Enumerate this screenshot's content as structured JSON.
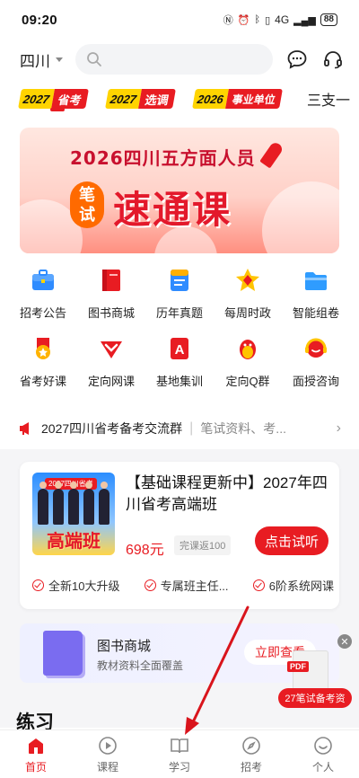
{
  "status_bar": {
    "time": "09:20",
    "signal": "4G",
    "battery": "88"
  },
  "header": {
    "location": "四川",
    "search_placeholder": ""
  },
  "tabs": [
    {
      "year": "2027",
      "kind": "省考"
    },
    {
      "year": "2027",
      "kind": "选调"
    },
    {
      "year": "2026",
      "kind": "事业单位"
    }
  ],
  "tab_more": "三支一",
  "banner": {
    "subtitle": "2026四川五方面人员",
    "badge_top": "笔",
    "badge_bottom": "试",
    "main": "速通课"
  },
  "grid": [
    {
      "label": "招考公告",
      "icon": "briefcase-icon"
    },
    {
      "label": "图书商城",
      "icon": "book-icon"
    },
    {
      "label": "历年真题",
      "icon": "exam-paper-icon"
    },
    {
      "label": "每周时政",
      "icon": "star-badge-icon"
    },
    {
      "label": "智能组卷",
      "icon": "folder-icon"
    },
    {
      "label": "省考好课",
      "icon": "medal-icon"
    },
    {
      "label": "定向网课",
      "icon": "heart-shield-icon"
    },
    {
      "label": "基地集训",
      "icon": "letter-a-icon"
    },
    {
      "label": "定向Q群",
      "icon": "penguin-icon"
    },
    {
      "label": "面授咨询",
      "icon": "headset-icon"
    }
  ],
  "notice": {
    "title": "2027四川省考备考交流群",
    "desc": "笔试资料、考..."
  },
  "course": {
    "thumb_tag": "2027四川省考",
    "thumb_big": "高端班",
    "title": "【基础课程更新中】2027年四川省考高端班",
    "price": "698元",
    "refund": "完课返100",
    "button": "点击试听",
    "features": [
      "全新10大升级",
      "专属班主任...",
      "6阶系统网课"
    ]
  },
  "store": {
    "title": "图书商城",
    "desc": "教材资料全面覆盖",
    "button": "立即查看"
  },
  "promo": {
    "pdf": "PDF",
    "label": "27笔试备考资"
  },
  "section_title": "练习",
  "bottom_nav": [
    {
      "label": "首页",
      "icon": "home-icon",
      "active": true
    },
    {
      "label": "课程",
      "icon": "play-circle-icon",
      "active": false
    },
    {
      "label": "学习",
      "icon": "open-book-icon",
      "active": false
    },
    {
      "label": "招考",
      "icon": "compass-icon",
      "active": false
    },
    {
      "label": "个人",
      "icon": "smile-icon",
      "active": false
    }
  ],
  "colors": {
    "brand_red": "#e81c22",
    "tab_yellow": "#ffd400",
    "page_gray": "#f5f5f7"
  }
}
